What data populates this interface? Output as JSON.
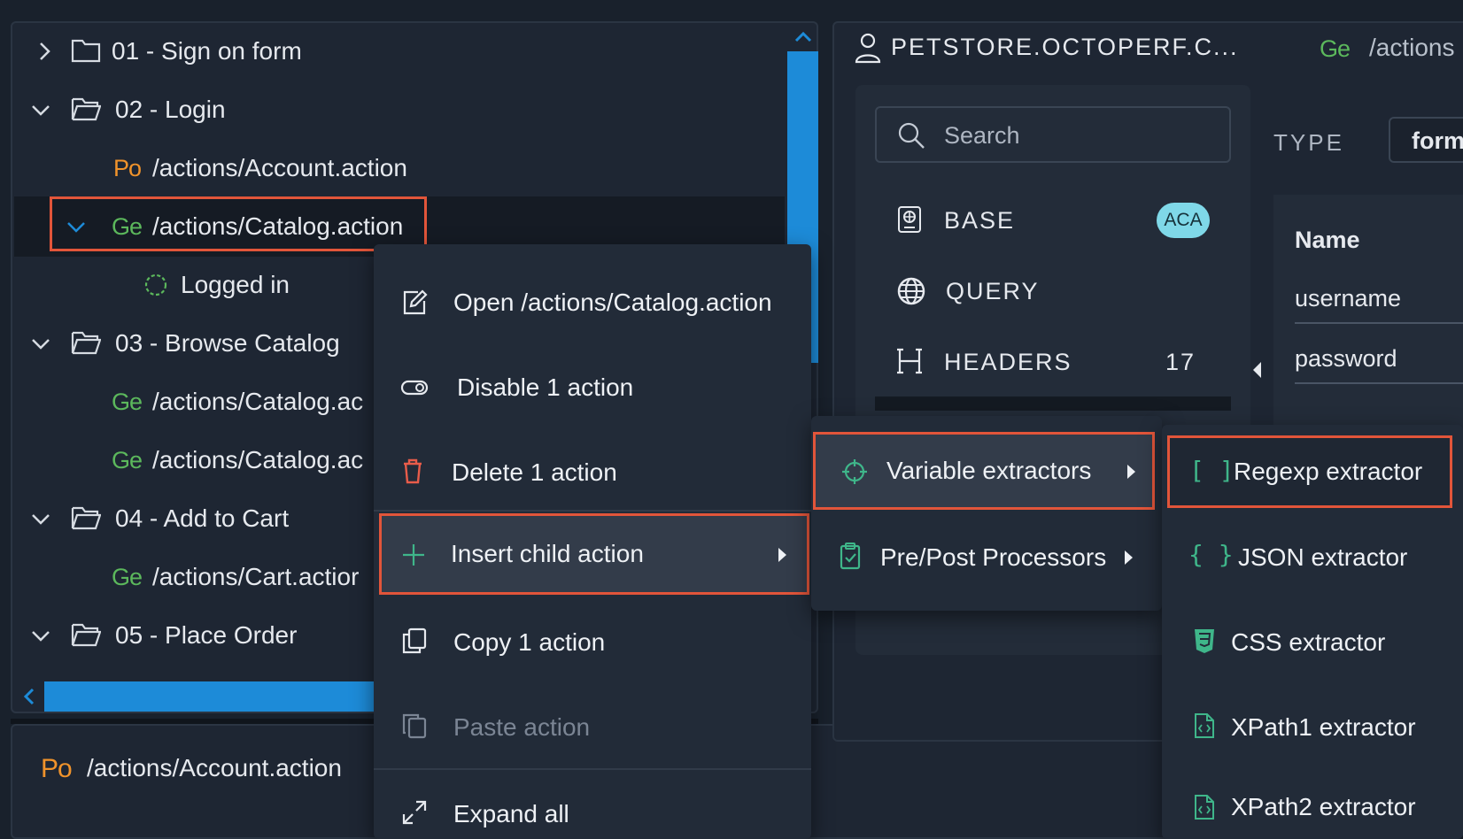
{
  "tree": {
    "rows": [
      {
        "label": "01 - Sign on form"
      },
      {
        "label": "02 - Login"
      },
      {
        "method": "Po",
        "label": "/actions/Account.action"
      },
      {
        "method": "Ge",
        "label": "/actions/Catalog.action"
      },
      {
        "label": "Logged in"
      },
      {
        "label": "03 - Browse Catalog"
      },
      {
        "method": "Ge",
        "label": "/actions/Catalog.ac"
      },
      {
        "method": "Ge",
        "label": "/actions/Catalog.ac"
      },
      {
        "label": "04 - Add to Cart"
      },
      {
        "method": "Ge",
        "label": "/actions/Cart.actior"
      },
      {
        "label": "05 - Place Order"
      }
    ]
  },
  "bottom": {
    "method": "Po",
    "label": "/actions/Account.action"
  },
  "request": {
    "host": "PETSTORE.OCTOPERF.C...",
    "method": "Ge",
    "path": "/actions",
    "search_placeholder": "Search",
    "sections": [
      {
        "label": "BASE",
        "badge": "ACA"
      },
      {
        "label": "QUERY"
      },
      {
        "label": "HEADERS",
        "count": "17"
      }
    ],
    "type_label": "TYPE",
    "type_value": "form",
    "params_header": "Name",
    "params": [
      "username",
      "password"
    ]
  },
  "context_menu": {
    "items": [
      {
        "label": "Open /actions/Catalog.action"
      },
      {
        "label": "Disable 1 action"
      },
      {
        "label": "Delete 1 action"
      },
      {
        "label": "Insert child action"
      },
      {
        "label": "Copy 1 action"
      },
      {
        "label": "Paste action"
      },
      {
        "label": "Expand all"
      }
    ]
  },
  "submenu": {
    "items": [
      {
        "label": "Variable extractors"
      },
      {
        "label": "Pre/Post Processors"
      }
    ]
  },
  "extractors": {
    "items": [
      {
        "label": "Regexp extractor"
      },
      {
        "label": "JSON extractor"
      },
      {
        "label": "CSS extractor"
      },
      {
        "label": "XPath1 extractor"
      },
      {
        "label": "XPath2 extractor"
      }
    ]
  },
  "colors": {
    "get": "#5cb85c",
    "post": "#f0932b",
    "accent": "#1d8bd8",
    "highlight": "#e2553a"
  }
}
